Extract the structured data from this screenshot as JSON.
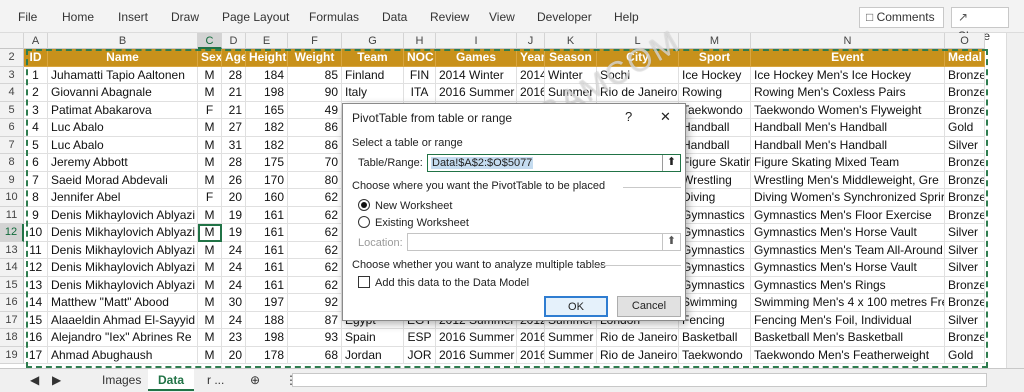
{
  "ribbon": {
    "menus": [
      "File",
      "Home",
      "Insert",
      "Draw",
      "Page Layout",
      "Formulas",
      "Data",
      "Review",
      "View",
      "Developer",
      "Help"
    ],
    "comments_label": "Comments",
    "share_label": "Share"
  },
  "grid": {
    "col_letters": [
      "A",
      "B",
      "C",
      "D",
      "E",
      "F",
      "G",
      "H",
      "I",
      "J",
      "K",
      "L",
      "M",
      "N",
      "O"
    ],
    "row_numbers": [
      "2",
      "3",
      "4",
      "5",
      "6",
      "7",
      "8",
      "9",
      "10",
      "11",
      "12",
      "13",
      "14",
      "15",
      "16",
      "17",
      "18",
      "19"
    ],
    "headers": [
      "ID",
      "Name",
      "Sex",
      "Age",
      "Height",
      "Weight",
      "Team",
      "NOC",
      "Games",
      "Year",
      "Season",
      "City",
      "Sport",
      "Event",
      "Medal"
    ],
    "rows": [
      [
        "1",
        "Juhamatti Tapio Aaltonen",
        "M",
        "28",
        "184",
        "85",
        "Finland",
        "FIN",
        "2014 Winter",
        "2014",
        "Winter",
        "Sochi",
        "Ice Hockey",
        "Ice Hockey Men's Ice Hockey",
        "Bronze"
      ],
      [
        "2",
        "Giovanni Abagnale",
        "M",
        "21",
        "198",
        "90",
        "Italy",
        "ITA",
        "2016 Summer",
        "2016",
        "Summer",
        "Rio de Janeiro",
        "Rowing",
        "Rowing Men's Coxless Pairs",
        "Bronze"
      ],
      [
        "3",
        "Patimat Abakarova",
        "F",
        "21",
        "165",
        "49",
        "",
        "",
        "",
        "",
        "",
        "",
        "Taekwondo",
        "Taekwondo Women's Flyweight",
        "Bronze"
      ],
      [
        "4",
        "Luc Abalo",
        "M",
        "27",
        "182",
        "86",
        "",
        "",
        "",
        "",
        "",
        "",
        "Handball",
        "Handball Men's Handball",
        "Gold"
      ],
      [
        "5",
        "Luc Abalo",
        "M",
        "31",
        "182",
        "86",
        "",
        "",
        "",
        "",
        "",
        "",
        "Handball",
        "Handball Men's Handball",
        "Silver"
      ],
      [
        "6",
        "Jeremy Abbott",
        "M",
        "28",
        "175",
        "70",
        "",
        "",
        "",
        "",
        "",
        "",
        "Figure Skatin",
        "Figure Skating Mixed Team",
        "Bronze"
      ],
      [
        "7",
        "Saeid Morad Abdevali",
        "M",
        "26",
        "170",
        "80",
        "",
        "",
        "",
        "",
        "",
        "",
        "Wrestling",
        "Wrestling Men's Middleweight, Gre",
        "Bronze"
      ],
      [
        "8",
        "Jennifer Abel",
        "F",
        "20",
        "160",
        "62",
        "",
        "",
        "",
        "",
        "",
        "",
        "Diving",
        "Diving Women's Synchronized Sprir",
        "Bronze"
      ],
      [
        "9",
        "Denis Mikhaylovich Ablyazi",
        "M",
        "19",
        "161",
        "62",
        "",
        "",
        "",
        "",
        "",
        "",
        "Gymnastics",
        "Gymnastics Men's Floor Exercise",
        "Bronze"
      ],
      [
        "10",
        "Denis Mikhaylovich Ablyazi",
        "M",
        "19",
        "161",
        "62",
        "",
        "",
        "",
        "",
        "",
        "",
        "Gymnastics",
        "Gymnastics Men's Horse Vault",
        "Silver"
      ],
      [
        "11",
        "Denis Mikhaylovich Ablyazi",
        "M",
        "24",
        "161",
        "62",
        "",
        "",
        "",
        "",
        "",
        "",
        "Gymnastics",
        "Gymnastics Men's Team All-Around",
        "Silver"
      ],
      [
        "12",
        "Denis Mikhaylovich Ablyazi",
        "M",
        "24",
        "161",
        "62",
        "",
        "",
        "",
        "",
        "",
        "",
        "Gymnastics",
        "Gymnastics Men's Horse Vault",
        "Silver"
      ],
      [
        "13",
        "Denis Mikhaylovich Ablyazi",
        "M",
        "24",
        "161",
        "62",
        "",
        "",
        "",
        "",
        "",
        "",
        "Gymnastics",
        "Gymnastics Men's Rings",
        "Bronze"
      ],
      [
        "14",
        "Matthew \"Matt\" Abood",
        "M",
        "30",
        "197",
        "92",
        "",
        "",
        "",
        "",
        "",
        "",
        "Swimming",
        "Swimming Men's 4 x 100 metres Fre",
        "Bronze"
      ],
      [
        "15",
        "Alaaeldin Ahmad El-Sayyid",
        "M",
        "24",
        "188",
        "87",
        "Egypt",
        "EGY",
        "2012 Summer",
        "2012",
        "Summer",
        "London",
        "Fencing",
        "Fencing Men's Foil, Individual",
        "Silver"
      ],
      [
        "16",
        "Alejandro \"Iex\" Abrines Re",
        "M",
        "23",
        "198",
        "93",
        "Spain",
        "ESP",
        "2016 Summer",
        "2016",
        "Summer",
        "Rio de Janeiro",
        "Basketball",
        "Basketball Men's Basketball",
        "Bronze"
      ],
      [
        "17",
        "Ahmad Abughaush",
        "M",
        "20",
        "178",
        "68",
        "Jordan",
        "JOR",
        "2016 Summer",
        "2016",
        "Summer",
        "Rio de Janeiro",
        "Taekwondo",
        "Taekwondo Men's Featherweight",
        "Gold"
      ]
    ]
  },
  "watermark": "VBAMCOM",
  "sheet_tabs": {
    "tabs": [
      "Images",
      "Data",
      "r ..."
    ],
    "active": "Data"
  },
  "dialog": {
    "title": "PivotTable from table or range",
    "help": "?",
    "close": "✕",
    "section1": "Select a table or range",
    "range_label": "Table/Range:",
    "range_value": "Data!$A$2:$O$5077",
    "section2": "Choose where you want the PivotTable to be placed",
    "opt_new": "New Worksheet",
    "opt_existing": "Existing Worksheet",
    "location_label": "Location:",
    "section3": "Choose whether you want to analyze multiple tables",
    "checkbox_label": "Add this data to the Data Model",
    "ok": "OK",
    "cancel": "Cancel",
    "selected_option": "New Worksheet"
  },
  "colors": {
    "header_fill": "#c8911b",
    "accent": "#217346"
  }
}
